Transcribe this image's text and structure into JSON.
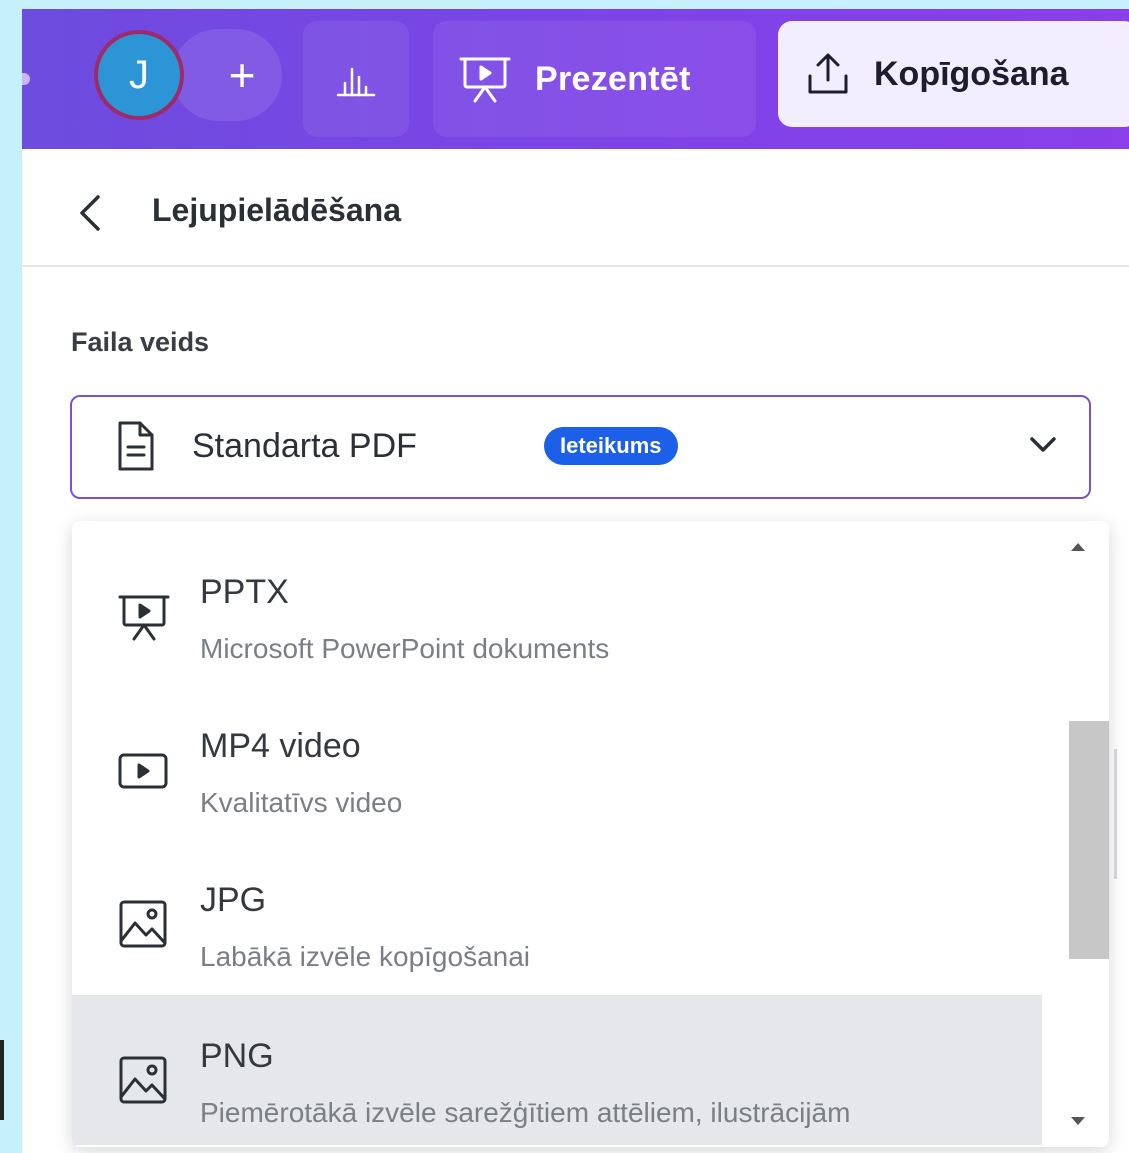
{
  "toolbar": {
    "avatar_initial": "J",
    "add_label": "+",
    "present_label": "Prezentēt",
    "share_label": "Kopīgošana",
    "colors": {
      "accent": "#7b44e6",
      "avatar": "#2b95d6"
    }
  },
  "panel": {
    "title": "Lejupielādēšana",
    "field_label": "Faila veids",
    "select": {
      "value": "Standarta PDF",
      "badge": "Ieteikums",
      "icon": "document-icon"
    }
  },
  "dropdown": {
    "options": [
      {
        "title": "PPTX",
        "subtitle": "Microsoft PowerPoint dokuments",
        "icon": "presentation-icon",
        "selected": false
      },
      {
        "title": "MP4 video",
        "subtitle": "Kvalitatīvs video",
        "icon": "video-icon",
        "selected": false
      },
      {
        "title": "JPG",
        "subtitle": "Labākā izvēle kopīgošanai",
        "icon": "image-icon",
        "selected": false
      },
      {
        "title": "PNG",
        "subtitle": "Piemērotākā izvēle sarežģītiem attēliem, ilustrācijām",
        "icon": "image-icon",
        "selected": true
      }
    ]
  }
}
